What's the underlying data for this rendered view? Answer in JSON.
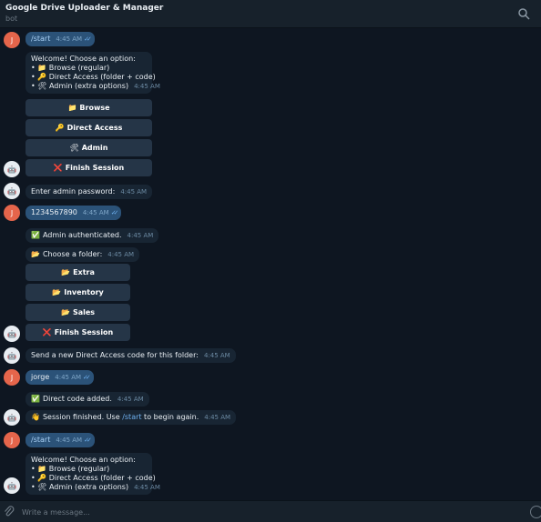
{
  "header": {
    "title": "Google Drive Uploader & Manager",
    "subtitle": "bot"
  },
  "avatars": {
    "user_initial": "J"
  },
  "icons": {
    "search": "search-icon",
    "attach": "paperclip-icon",
    "emoji": "emoji-icon"
  },
  "messages": {
    "m1": {
      "text": "/start",
      "time": "4:45 AM"
    },
    "m2": {
      "lines": [
        "Welcome! Choose an option:",
        "• 📁 Browse (regular)",
        "• 🔑 Direct Access (folder + code)",
        "• 🛠 Admin (extra options)"
      ],
      "time": "4:45 AM"
    },
    "m3": {
      "text": "Enter admin password:",
      "time": "4:45 AM"
    },
    "m4": {
      "text": "1234567890",
      "time": "4:45 AM"
    },
    "m5": {
      "icon": "✅",
      "text": "Admin authenticated.",
      "time": "4:45 AM"
    },
    "m6": {
      "icon": "📂",
      "text": "Choose a folder:",
      "time": "4:45 AM"
    },
    "m7": {
      "text": "Send a new Direct Access code for this folder:",
      "time": "4:45 AM"
    },
    "m8": {
      "text": "jorge",
      "time": "4:45 AM"
    },
    "m9": {
      "icon": "✅",
      "text": "Direct code added.",
      "time": "4:45 AM"
    },
    "m10": {
      "icon": "👋",
      "text_before": "Session finished. Use ",
      "link": "/start",
      "text_after": " to begin again.",
      "time": "4:45 AM"
    },
    "m11": {
      "text": "/start",
      "time": "4:45 AM"
    },
    "m12": {
      "lines": [
        "Welcome! Choose an option:",
        "• 📁 Browse (regular)",
        "• 🔑 Direct Access (folder + code)",
        "• 🛠 Admin (extra options)"
      ],
      "time": "4:45 AM"
    }
  },
  "keyboard1": [
    {
      "icon": "📁",
      "label": "Browse"
    },
    {
      "icon": "🔑",
      "label": "Direct Access"
    },
    {
      "icon": "🛠",
      "label": "Admin"
    },
    {
      "icon": "❌",
      "label": "Finish Session"
    }
  ],
  "keyboard2": [
    {
      "icon": "📂",
      "label": "Extra"
    },
    {
      "icon": "📂",
      "label": "Inventory"
    },
    {
      "icon": "📂",
      "label": "Sales"
    },
    {
      "icon": "❌",
      "label": "Finish Session"
    }
  ],
  "composer": {
    "placeholder": "Write a message..."
  }
}
